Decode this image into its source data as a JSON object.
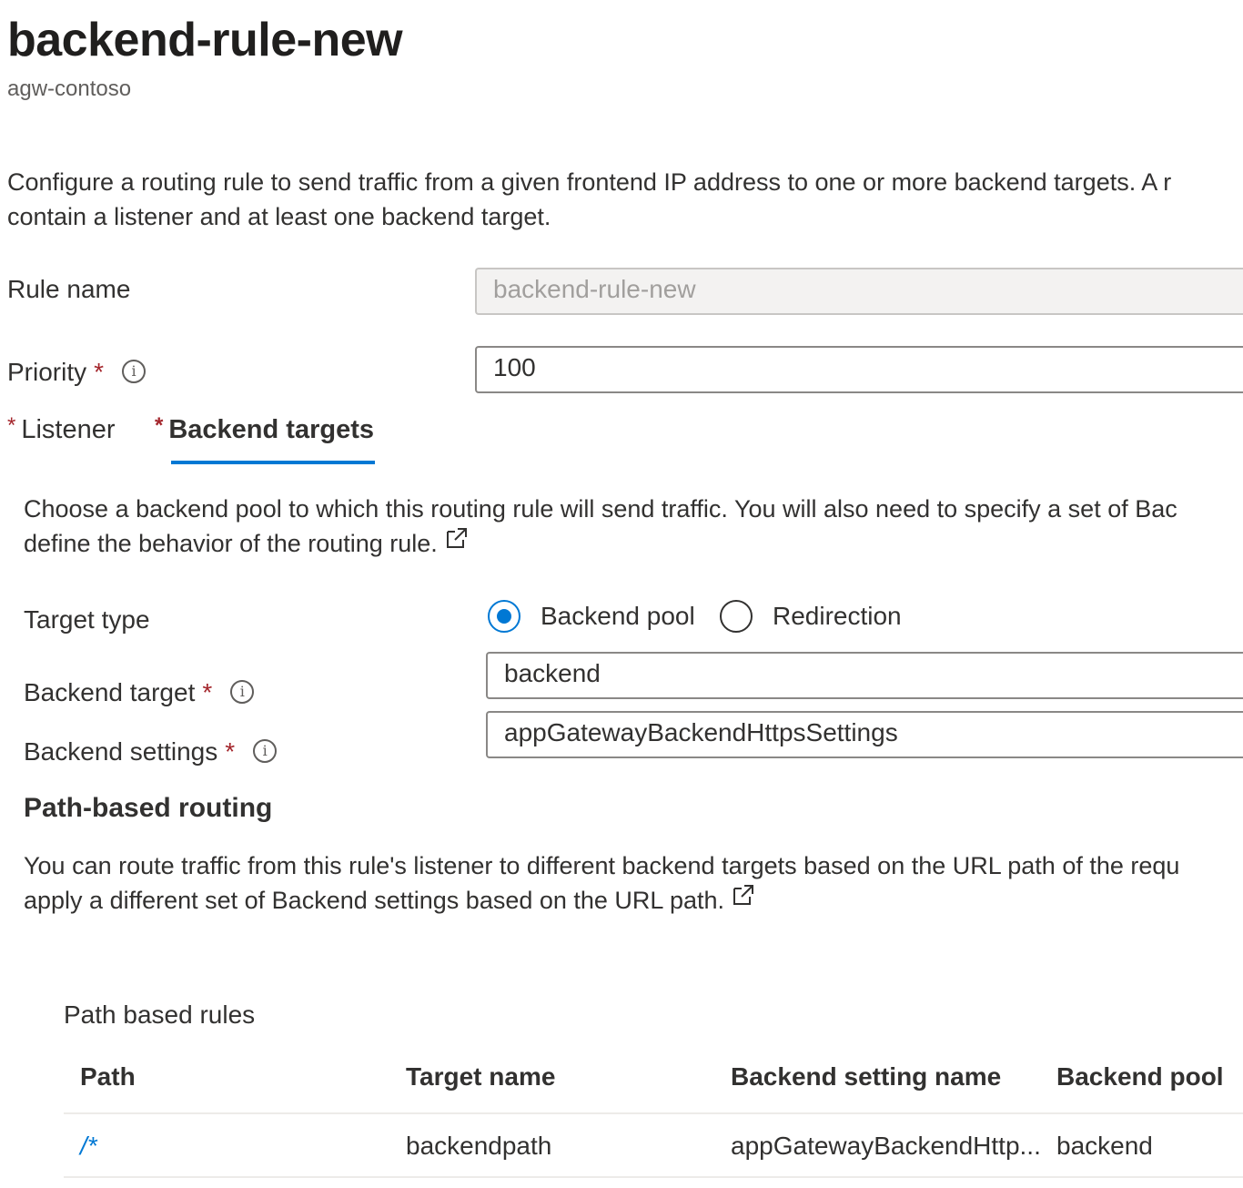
{
  "page": {
    "title": "backend-rule-new",
    "subtitle": "agw-contoso",
    "description_line1": "Configure a routing rule to send traffic from a given frontend IP address to one or more backend targets. A r",
    "description_line2": "contain a listener and at least one backend target."
  },
  "form": {
    "rule_name_label": "Rule name",
    "rule_name_value": "backend-rule-new",
    "priority_label": "Priority",
    "priority_value": "100",
    "required_marker": "*",
    "info_glyph": "i"
  },
  "tabs": [
    {
      "label": "Listener",
      "active": false
    },
    {
      "label": "Backend targets",
      "active": true
    }
  ],
  "backend_targets": {
    "description_line1": "Choose a backend pool to which this routing rule will send traffic. You will also need to specify a set of Bac",
    "description_line2": "define the behavior of the routing rule.",
    "target_type_label": "Target type",
    "target_type_options": [
      {
        "label": "Backend pool",
        "selected": true
      },
      {
        "label": "Redirection",
        "selected": false
      }
    ],
    "backend_target_label": "Backend target",
    "backend_target_value": "backend",
    "backend_settings_label": "Backend settings",
    "backend_settings_value": "appGatewayBackendHttpsSettings"
  },
  "path_routing": {
    "heading": "Path-based routing",
    "description_line1": "You can route traffic from this rule's listener to different backend targets based on the URL path of the requ",
    "description_line2": "apply a different set of Backend settings based on the URL path.",
    "table_title": "Path based rules",
    "columns": [
      "Path",
      "Target name",
      "Backend setting name",
      "Backend pool"
    ],
    "rows": [
      {
        "path": "/*",
        "target_name": "backendpath",
        "backend_setting_name": "appGatewayBackendHttp...",
        "backend_pool": "backend"
      }
    ]
  },
  "colors": {
    "accent": "#0078d4",
    "required": "#a4262c",
    "text": "#323130"
  },
  "icons": [
    "info-icon",
    "external-link-icon",
    "radio-selected-icon",
    "radio-unselected-icon"
  ]
}
